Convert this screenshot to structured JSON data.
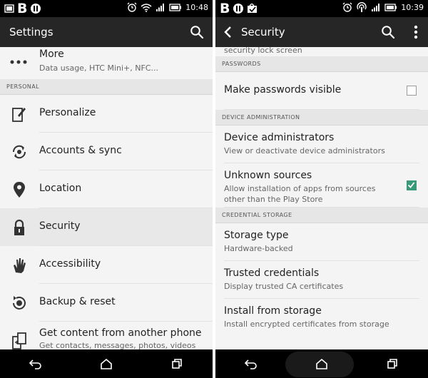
{
  "left": {
    "status": {
      "time": "10:48"
    },
    "appbar": {
      "title": "Settings",
      "search_icon": "search-icon"
    },
    "more": {
      "label": "More",
      "sub": "Data usage, HTC Mini+, NFC..."
    },
    "personal_header": "PERSONAL",
    "items": [
      {
        "label": "Personalize",
        "icon": "personalize-icon"
      },
      {
        "label": "Accounts & sync",
        "icon": "sync-icon"
      },
      {
        "label": "Location",
        "icon": "location-pin-icon"
      },
      {
        "label": "Security",
        "icon": "lock-icon",
        "selected": true
      },
      {
        "label": "Accessibility",
        "icon": "hand-icon"
      },
      {
        "label": "Backup & reset",
        "icon": "backup-icon"
      }
    ],
    "get_content": {
      "label": "Get content from another phone",
      "sub": "Get contacts, messages, photos, videos"
    }
  },
  "right": {
    "status": {
      "time": "10:39"
    },
    "appbar": {
      "title": "Security"
    },
    "partial_text": "security lock screen",
    "passwords_header": "PASSWORDS",
    "make_passwords_visible": {
      "label": "Make passwords visible",
      "checked": false
    },
    "device_admin_header": "DEVICE ADMINISTRATION",
    "device_administrators": {
      "label": "Device administrators",
      "sub": "View or deactivate device administrators"
    },
    "unknown_sources": {
      "label": "Unknown sources",
      "sub1": "Allow installation of apps from sources",
      "sub2": "other than the Play Store",
      "checked": true
    },
    "credential_header": "CREDENTIAL STORAGE",
    "storage_type": {
      "label": "Storage type",
      "sub": "Hardware-backed"
    },
    "trusted_credentials": {
      "label": "Trusted credentials",
      "sub": "Display trusted CA certificates"
    },
    "install_from_storage": {
      "label": "Install from storage",
      "sub": "Install encrypted certificates from storage"
    }
  },
  "colors": {
    "accent_check": "#3a9a78",
    "appbar": "#262626",
    "statusbar": "#000000"
  }
}
